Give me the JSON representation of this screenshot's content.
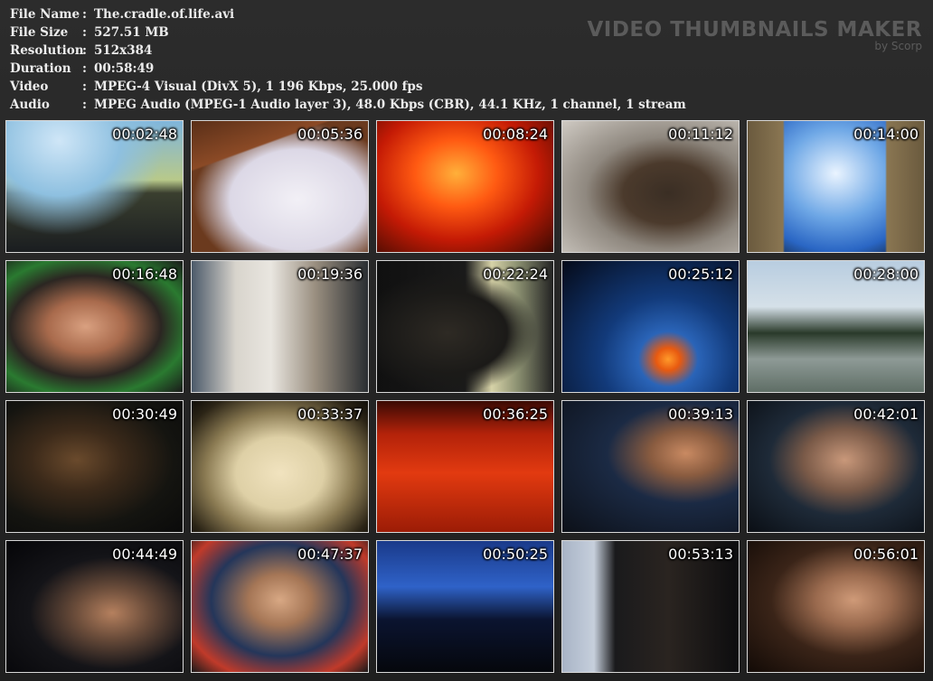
{
  "info": [
    {
      "label": "File Name",
      "sep": ":",
      "value": "The.cradle.of.life.avi"
    },
    {
      "label": "File Size",
      "sep": ":",
      "value": "527.51 MB"
    },
    {
      "label": "Resolution",
      "sep": ":",
      "value": "512x384"
    },
    {
      "label": "Duration",
      "sep": ":",
      "value": "00:58:49"
    },
    {
      "label": "Video",
      "sep": ":",
      "value": "MPEG-4 Visual (DivX 5), 1 196 Kbps, 25.000 fps"
    },
    {
      "label": "Audio",
      "sep": ":",
      "value": "MPEG Audio (MPEG-1 Audio layer 3), 48.0 Kbps (CBR), 44.1 KHz, 1 channel, 1 stream"
    }
  ],
  "brand": {
    "title": "VIDEO THUMBNAILS MAKER",
    "subtitle": "by Scorp"
  },
  "thumbnails": [
    {
      "time": "00:02:48",
      "scene": "car-landscape"
    },
    {
      "time": "00:05:36",
      "scene": "notebook-writing"
    },
    {
      "time": "00:08:24",
      "scene": "lava"
    },
    {
      "time": "00:11:12",
      "scene": "rock-hand"
    },
    {
      "time": "00:14:00",
      "scene": "church-towers-sky"
    },
    {
      "time": "00:16:48",
      "scene": "man-glasses-lab"
    },
    {
      "time": "00:19:36",
      "scene": "men-working"
    },
    {
      "time": "00:22:24",
      "scene": "man-in-car"
    },
    {
      "time": "00:25:12",
      "scene": "blue-glow"
    },
    {
      "time": "00:28:00",
      "scene": "forest-steam"
    },
    {
      "time": "00:30:49",
      "scene": "dark-portrait"
    },
    {
      "time": "00:33:37",
      "scene": "microscope-specimens"
    },
    {
      "time": "00:36:25",
      "scene": "red-liquid"
    },
    {
      "time": "00:39:13",
      "scene": "man-at-microscope"
    },
    {
      "time": "00:42:01",
      "scene": "bearded-man"
    },
    {
      "time": "00:44:49",
      "scene": "man-lab-dark"
    },
    {
      "time": "00:47:37",
      "scene": "man-interview"
    },
    {
      "time": "00:50:25",
      "scene": "control-room"
    },
    {
      "time": "00:53:13",
      "scene": "man-computer"
    },
    {
      "time": "00:56:01",
      "scene": "man-interview-2"
    }
  ]
}
